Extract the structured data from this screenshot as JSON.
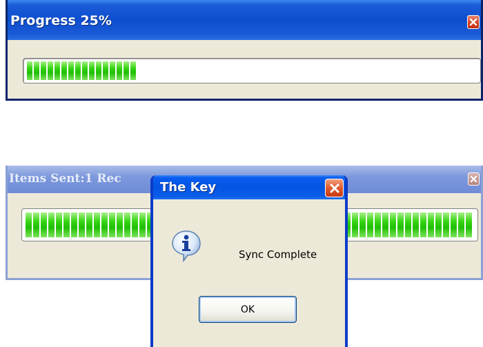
{
  "progress_window": {
    "title": "Progress 25%",
    "progress": 0.25,
    "close_icon": "close-icon"
  },
  "sync_window": {
    "title": "Items Sent:1  Rec",
    "progress": 1.0,
    "close_icon": "close-icon"
  },
  "dialog": {
    "title": "The Key",
    "message": "Sync Complete",
    "ok_label": "OK",
    "icon": "info-icon",
    "close_icon": "close-icon"
  },
  "colors": {
    "titlebar_active": "#0d4ecf",
    "titlebar_inactive": "#7d98dc",
    "progress_green": "#1fbf05",
    "close_red": "#d6401e",
    "window_bg": "#ece9d8"
  }
}
